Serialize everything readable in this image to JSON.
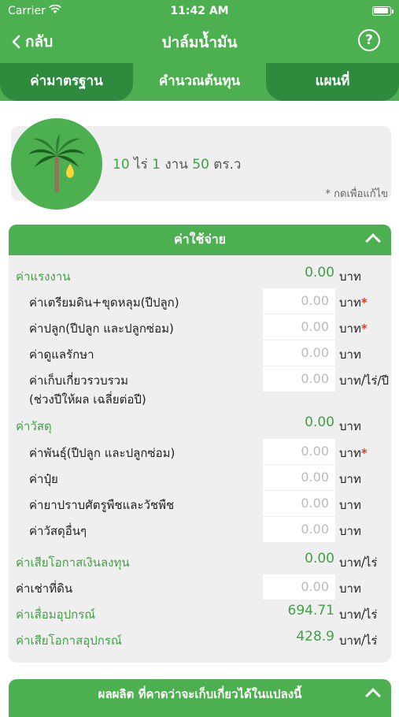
{
  "status": {
    "carrier": "Carrier",
    "time": "11:42 AM"
  },
  "nav": {
    "back_label": "กลับ",
    "title": "ปาล์มน้ำมัน",
    "help_label": "?"
  },
  "tabs": [
    {
      "label": "ค่ามาตรฐาน"
    },
    {
      "label": "คำนวณต้นทุน"
    },
    {
      "label": "แผนที่"
    }
  ],
  "plot": {
    "rai": "10",
    "rai_unit": "ไร่",
    "ngan": "1",
    "ngan_unit": "งาน",
    "wa": "50",
    "wa_unit": "ตร.ว",
    "edit_hint": "* กดเพื่อแก้ไข"
  },
  "expenses": {
    "header": "ค่าใช้จ่าย",
    "labor": {
      "label": "ค่าแรงงาน",
      "value": "0.00",
      "unit": "บาท"
    },
    "labor_items": [
      {
        "label": "ค่าเตรียมดิน+ขุดหลุม(ปีปลูก)",
        "placeholder": "0.00",
        "unit": "บาท",
        "required": "*"
      },
      {
        "label": "ค่าปลูก(ปีปลูก และปลูกซ่อม)",
        "placeholder": "0.00",
        "unit": "บาท",
        "required": "*"
      },
      {
        "label": "ค่าดูแลรักษา",
        "placeholder": "0.00",
        "unit": "บาท",
        "required": ""
      },
      {
        "label": "ค่าเก็บเกี่ยวรวบรวม",
        "label2": "(ช่วงปีให้ผล เฉลี่ยต่อปี)",
        "placeholder": "0.00",
        "unit": "บาท/ไร่/ปี",
        "required": ""
      }
    ],
    "material": {
      "label": "ค่าวัสดุ",
      "value": "0.00",
      "unit": "บาท"
    },
    "material_items": [
      {
        "label": "ค่าพันธุ์(ปีปลูก และปลูกซ่อม)",
        "placeholder": "0.00",
        "unit": "บาท",
        "required": "*"
      },
      {
        "label": "ค่าปุ๋ย",
        "placeholder": "0.00",
        "unit": "บาท",
        "required": ""
      },
      {
        "label": "ค่ายาปราบศัตรูพืชและวัชพืช",
        "placeholder": "0.00",
        "unit": "บาท",
        "required": ""
      },
      {
        "label": "ค่าวัสดุอื่นๆ",
        "placeholder": "0.00",
        "unit": "บาท",
        "required": ""
      }
    ],
    "opportunity": {
      "label": "ค่าเสียโอกาสเงินลงทุน",
      "value": "0.00",
      "unit": "บาท/ไร่"
    },
    "land_rent": {
      "label": "ค่าเช่าที่ดิน",
      "placeholder": "0.00",
      "unit": "บาท"
    },
    "depreciation": {
      "label": "ค่าเสื่อมอุปกรณ์",
      "value": "694.71",
      "unit": "บาท/ไร่"
    },
    "equipment_opportunity": {
      "label": "ค่าเสียโอกาสอุปกรณ์",
      "value": "428.9",
      "unit": "บาท/ไร่"
    }
  },
  "yield_section": {
    "header": "ผลผลิต ที่คาดว่าจะเก็บเกี่ยวได้ในแปลงนี้"
  },
  "colors": {
    "primary": "#4caf50",
    "primary_dark": "#2e8b3e",
    "accent_text": "#43a047",
    "required": "#e53935"
  }
}
